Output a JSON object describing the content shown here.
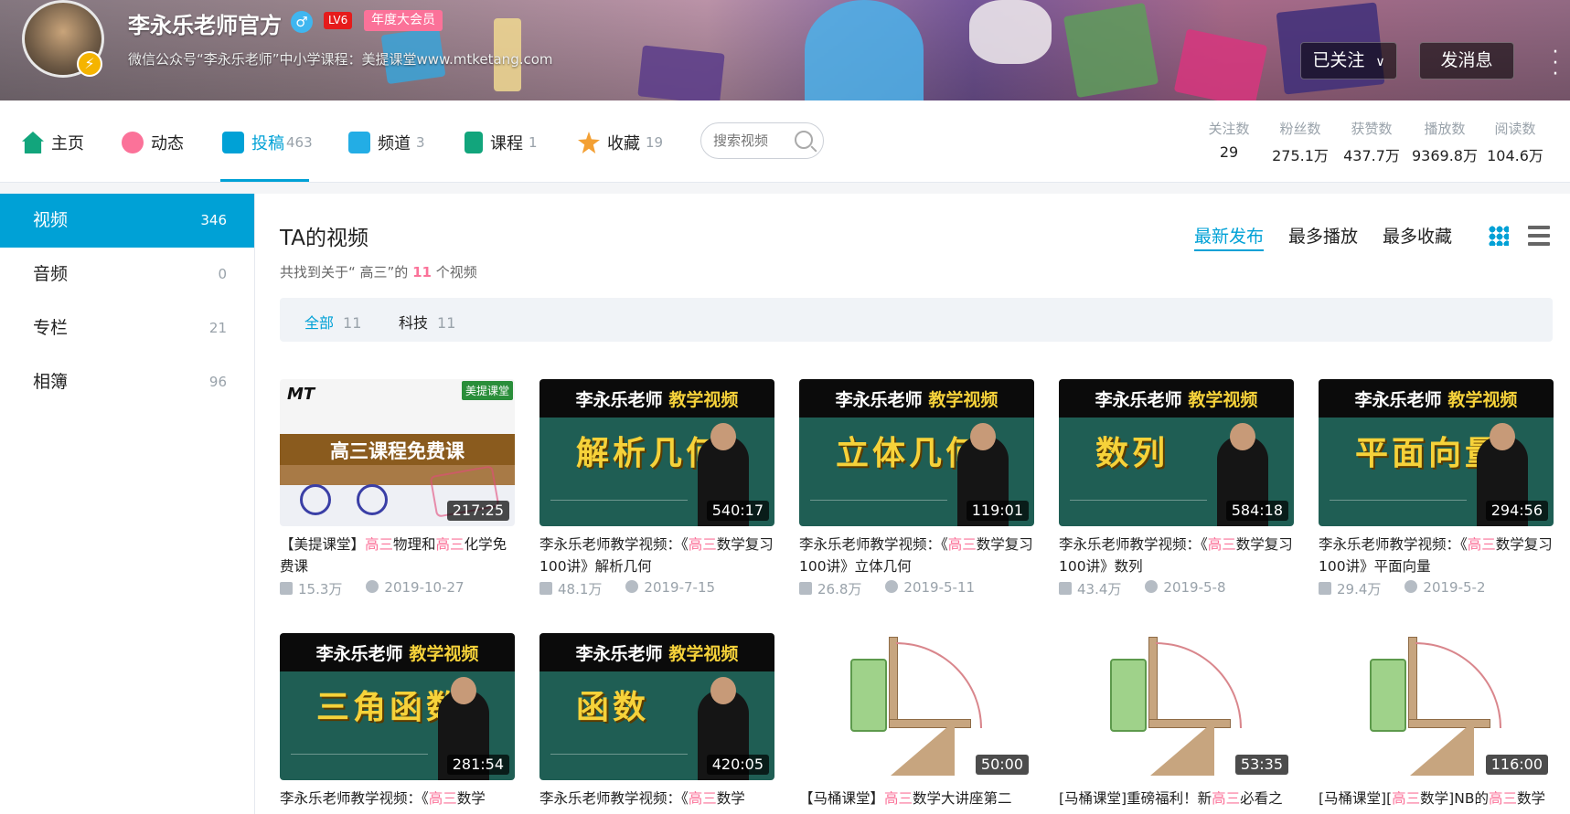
{
  "header": {
    "username": "李永乐老师官方",
    "gender_icon": "♂",
    "level": "LV6",
    "vip_badge": "年度大会员",
    "signature": "微信公众号“李永乐老师”中小学课程：美提课堂www.mtketang.com",
    "follow_button": "已关注",
    "message_button": "发消息",
    "avatar_badge_icon": "⚡"
  },
  "nav": {
    "tabs": [
      {
        "label": "主页",
        "count": "",
        "icon": "home-icon",
        "color": "#23ade5"
      },
      {
        "label": "动态",
        "count": "",
        "icon": "dynamic-icon",
        "color": "#fb7299"
      },
      {
        "label": "投稿",
        "count": "463",
        "icon": "upload-icon",
        "color": "#00a1d6"
      },
      {
        "label": "频道",
        "count": "3",
        "icon": "channel-icon",
        "color": "#23ade5"
      },
      {
        "label": "课程",
        "count": "1",
        "icon": "course-icon",
        "color": "#12a57c"
      },
      {
        "label": "收藏",
        "count": "19",
        "icon": "favorite-icon",
        "color": "#f3a034"
      }
    ],
    "search_placeholder": "搜索视频",
    "stats": [
      {
        "label": "关注数",
        "value": "29"
      },
      {
        "label": "粉丝数",
        "value": "275.1万"
      },
      {
        "label": "获赞数",
        "value": "437.7万"
      },
      {
        "label": "播放数",
        "value": "9369.8万"
      },
      {
        "label": "阅读数",
        "value": "104.6万"
      }
    ]
  },
  "sidebar": {
    "items": [
      {
        "label": "视频",
        "count": "346"
      },
      {
        "label": "音频",
        "count": "0"
      },
      {
        "label": "专栏",
        "count": "21"
      },
      {
        "label": "相簿",
        "count": "96"
      }
    ]
  },
  "main": {
    "title": "TA的视频",
    "result_prefix": "共找到关于“ 高三”的",
    "result_count": "11",
    "result_suffix": "个视频",
    "sort": [
      "最新发布",
      "最多播放",
      "最多收藏"
    ],
    "filters": [
      {
        "label": "全部",
        "count": "11"
      },
      {
        "label": "科技",
        "count": "11"
      }
    ]
  },
  "videos": [
    {
      "thumb": "mt",
      "thumb_title": "高三课程免费课",
      "thumb_logo": "MT",
      "thumb_tag": "美提课堂",
      "duration": "217:25",
      "title_parts": [
        "【美提课堂】",
        "高三",
        "物理和",
        "高三",
        "化学免费课"
      ],
      "plays": "15.3万",
      "date": "2019-10-27"
    },
    {
      "thumb": "teal",
      "thumb_title": "解析几何",
      "duration": "540:17",
      "title_parts": [
        "李永乐老师教学视频：《",
        "高三",
        "数学复习100讲》解析几何"
      ],
      "plays": "48.1万",
      "date": "2019-7-15"
    },
    {
      "thumb": "teal",
      "thumb_title": "立体几何",
      "duration": "119:01",
      "title_parts": [
        "李永乐老师教学视频：《",
        "高三",
        "数学复习100讲》立体几何"
      ],
      "plays": "26.8万",
      "date": "2019-5-11"
    },
    {
      "thumb": "teal",
      "thumb_title": "数列",
      "duration": "584:18",
      "title_parts": [
        "李永乐老师教学视频：《",
        "高三",
        "数学复习100讲》数列"
      ],
      "plays": "43.4万",
      "date": "2019-5-8"
    },
    {
      "thumb": "teal",
      "thumb_title": "平面向量",
      "duration": "294:56",
      "title_parts": [
        "李永乐老师教学视频：《",
        "高三",
        "数学复习100讲》平面向量"
      ],
      "plays": "29.4万",
      "date": "2019-5-2"
    },
    {
      "thumb": "teal",
      "thumb_title": "三角函数",
      "duration": "281:54",
      "title_parts": [
        "李永乐老师教学视频：《",
        "高三",
        "数学"
      ],
      "plays": "",
      "date": ""
    },
    {
      "thumb": "teal",
      "thumb_title": "函数",
      "duration": "420:05",
      "title_parts": [
        "李永乐老师教学视频：《",
        "高三",
        "数学"
      ],
      "plays": "",
      "date": ""
    },
    {
      "thumb": "ruler",
      "thumb_title": "",
      "duration": "50:00",
      "title_parts": [
        "【马桶课堂】",
        "高三",
        "数学大讲座第二"
      ],
      "plays": "",
      "date": ""
    },
    {
      "thumb": "ruler",
      "thumb_title": "",
      "duration": "53:35",
      "title_parts": [
        "[马桶课堂]重磅福利！新",
        "高三",
        "必看之"
      ],
      "plays": "",
      "date": ""
    },
    {
      "thumb": "ruler",
      "thumb_title": "",
      "duration": "116:00",
      "title_parts": [
        "[马桶课堂][",
        "高三",
        "数学]NB的",
        "高三",
        "数学"
      ],
      "plays": "",
      "date": ""
    }
  ],
  "thumb_header": {
    "name": "李永乐老师",
    "tag": "教学视频"
  },
  "colors": {
    "accent": "#00a1d6",
    "pink": "#fb7299",
    "muted": "#99a2aa"
  }
}
